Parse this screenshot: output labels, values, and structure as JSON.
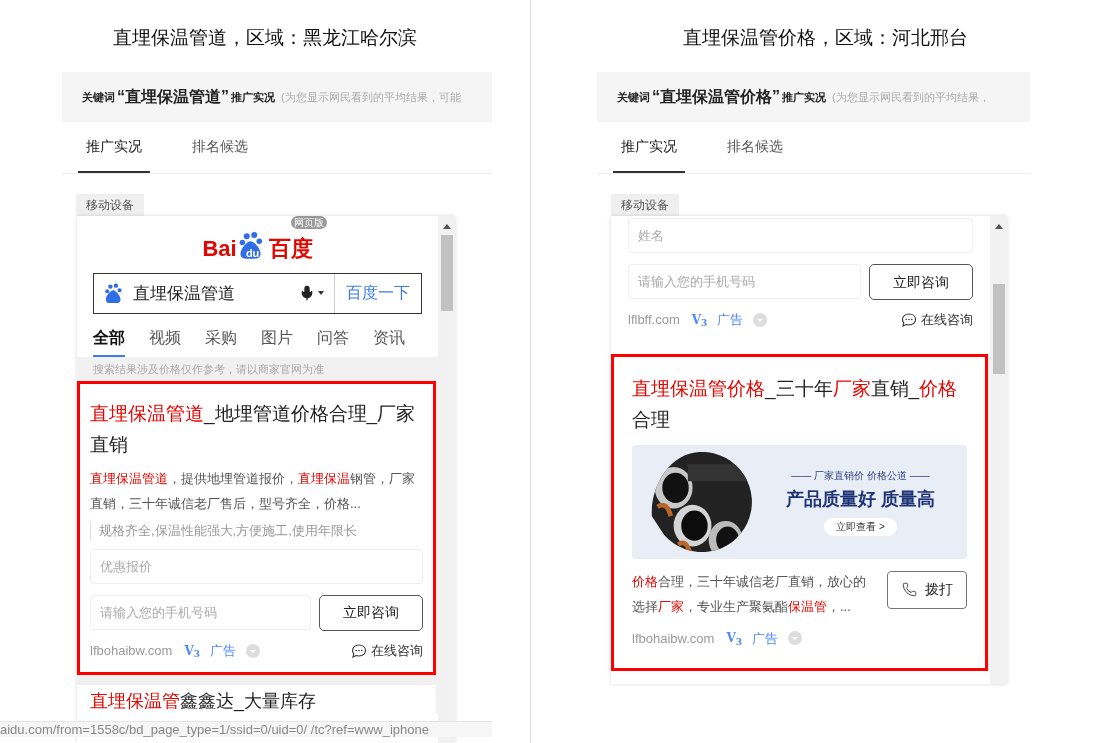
{
  "panels": [
    {
      "caption": "直埋保温管道，区域：黑龙江哈尔滨",
      "keyword_label": "关键词",
      "keyword": "“直埋保温管道”",
      "section": "推广实况",
      "note": "(为您显示网民看到的平均结果，可能",
      "tabs": [
        {
          "label": "推广实况",
          "selected": true
        },
        {
          "label": "排名候选",
          "selected": false
        }
      ],
      "device": "移动设备",
      "blocks": [
        {
          "kind": "baidu_header",
          "logo": [
            "Bai",
            "du",
            "百度"
          ],
          "badge": "网页版",
          "query": "直埋保温管道",
          "search_button": "百度一下",
          "nav": [
            {
              "label": "全部",
              "selected": true
            },
            {
              "label": "视频",
              "selected": false
            },
            {
              "label": "采购",
              "selected": false
            },
            {
              "label": "图片",
              "selected": false
            },
            {
              "label": "问答",
              "selected": false
            },
            {
              "label": "资讯",
              "selected": false
            }
          ],
          "notice": "搜索结果涉及价格仅作参考，请以商家官网为准"
        },
        {
          "kind": "ad",
          "highlighted": true,
          "title": [
            {
              "text": "直埋保温管道",
              "hit": true
            },
            {
              "text": "_地埋管道价格合理_厂家直销",
              "hit": false
            }
          ],
          "desc": [
            {
              "text": "直埋保温管道",
              "hit": true
            },
            {
              "text": "，提供地埋管道报价，",
              "hit": false
            },
            {
              "text": "直埋保温",
              "hit": true
            },
            {
              "text": "钢管，厂家直销，三十年诚信老厂售后，型号齐全，价格...",
              "hit": false
            }
          ],
          "sub": "规格齐全,保温性能强大,方便施工,使用年限长",
          "name_placeholder": "优惠报价",
          "phone_placeholder": "请输入您的手机号码",
          "consult_button": "立即咨询",
          "domain": "lfbohaibw.com",
          "v": "V$_{3}$",
          "ad_label": "广告",
          "chat": "在线咨询"
        },
        {
          "kind": "result_peek",
          "title": [
            {
              "text": "直埋保温管",
              "hit": true
            },
            {
              "text": "鑫鑫达_大量库存",
              "hit": false
            }
          ]
        }
      ],
      "status_url": "aidu.com/from=1558c/bd_page_type=1/ssid=0/uid=0/ /tc?ref=www_iphone"
    },
    {
      "caption": "直埋保温管价格，区域：河北邢台",
      "keyword_label": "关键词",
      "keyword": "“直埋保温管价格”",
      "section": "推广实况",
      "note": "(为您显示网民看到的平均结果，",
      "tabs": [
        {
          "label": "推广实况",
          "selected": true
        },
        {
          "label": "排名候选",
          "selected": false
        }
      ],
      "device": "移动设备",
      "blocks": [
        {
          "kind": "form_tail",
          "name_placeholder": "姓名",
          "phone_placeholder": "请输入您的手机号码",
          "consult_button": "立即咨询",
          "domain": "lflbff.com",
          "v": "V$_{3}$",
          "ad_label": "广告",
          "chat": "在线咨询"
        },
        {
          "kind": "ad",
          "highlighted": true,
          "title": [
            {
              "text": "直埋保温管价格",
              "hit": true
            },
            {
              "text": "_三十年",
              "hit": false
            },
            {
              "text": "厂家",
              "hit": true
            },
            {
              "text": "直销_",
              "hit": false
            },
            {
              "text": "价格",
              "hit": true
            },
            {
              "text": "合理",
              "hit": false
            }
          ],
          "banner": {
            "tagline": "—— 厂家直销价 价格公道 ——",
            "headline": "产品质量好 质量高",
            "button": "立即查看 >"
          },
          "desc": [
            {
              "text": "价格",
              "hit": true
            },
            {
              "text": "合理，三十年诚信老厂直销，放心的选择",
              "hit": false
            },
            {
              "text": "厂家",
              "hit": true
            },
            {
              "text": "，专业生产聚氨酯",
              "hit": false
            },
            {
              "text": "保温管",
              "hit": true
            },
            {
              "text": "，...",
              "hit": false
            }
          ],
          "call_button": "拨打",
          "domain": "lfbohaibw.com",
          "v": "V$_{3}$",
          "ad_label": "广告"
        }
      ]
    }
  ]
}
